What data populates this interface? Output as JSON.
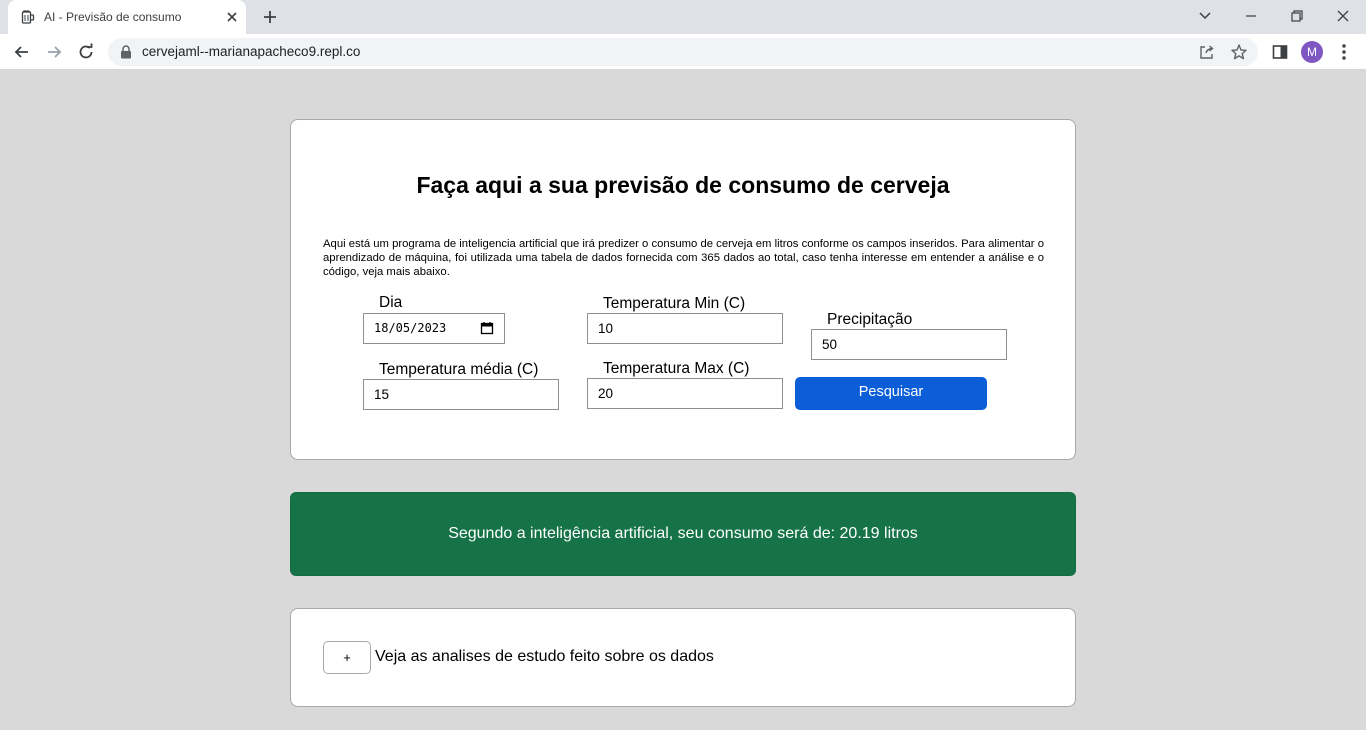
{
  "browser": {
    "tab_title": "AI - Previsão de consumo",
    "url": "cervejaml--marianapacheco9.repl.co",
    "avatar_initial": "M",
    "icons": [
      "beer-mug-icon",
      "close-icon",
      "plus-icon",
      "chevron-down-icon",
      "minimize-icon",
      "restore-icon",
      "close-window-icon",
      "back-icon",
      "forward-icon",
      "reload-icon",
      "lock-icon",
      "share-icon",
      "star-icon",
      "side-panel-icon",
      "kebab-menu-icon"
    ]
  },
  "page": {
    "heading": "Faça aqui a sua previsão de consumo de cerveja",
    "intro": "Aqui está um programa de inteligencia artificial que irá predizer o consumo de cerveja em litros conforme os campos inseridos. Para alimentar o aprendizado de máquina, foi utilizada uma tabela de dados fornecida com 365 dados ao total, caso tenha interesse em entender a análise e o código, veja mais abaixo.",
    "form": {
      "dia": {
        "label": "Dia",
        "value": "18/05/2023"
      },
      "temp_min": {
        "label": "Temperatura Min (C)",
        "value": "10"
      },
      "precipitacao": {
        "label": "Precipitação",
        "value": "50"
      },
      "temp_media": {
        "label": "Temperatura média (C)",
        "value": "15"
      },
      "temp_max": {
        "label": "Temperatura Max (C)",
        "value": "20"
      },
      "submit_label": "Pesquisar"
    },
    "result": {
      "text": "Segundo a inteligência artificial, seu consumo será de: 20.19 litros",
      "color": "#157347"
    },
    "analysis": {
      "toggle_label": "+",
      "text": "Veja as analises de estudo feito sobre os dados"
    },
    "colors": {
      "primary_button": "#0b5ed7",
      "background": "#d9d9d9"
    }
  }
}
